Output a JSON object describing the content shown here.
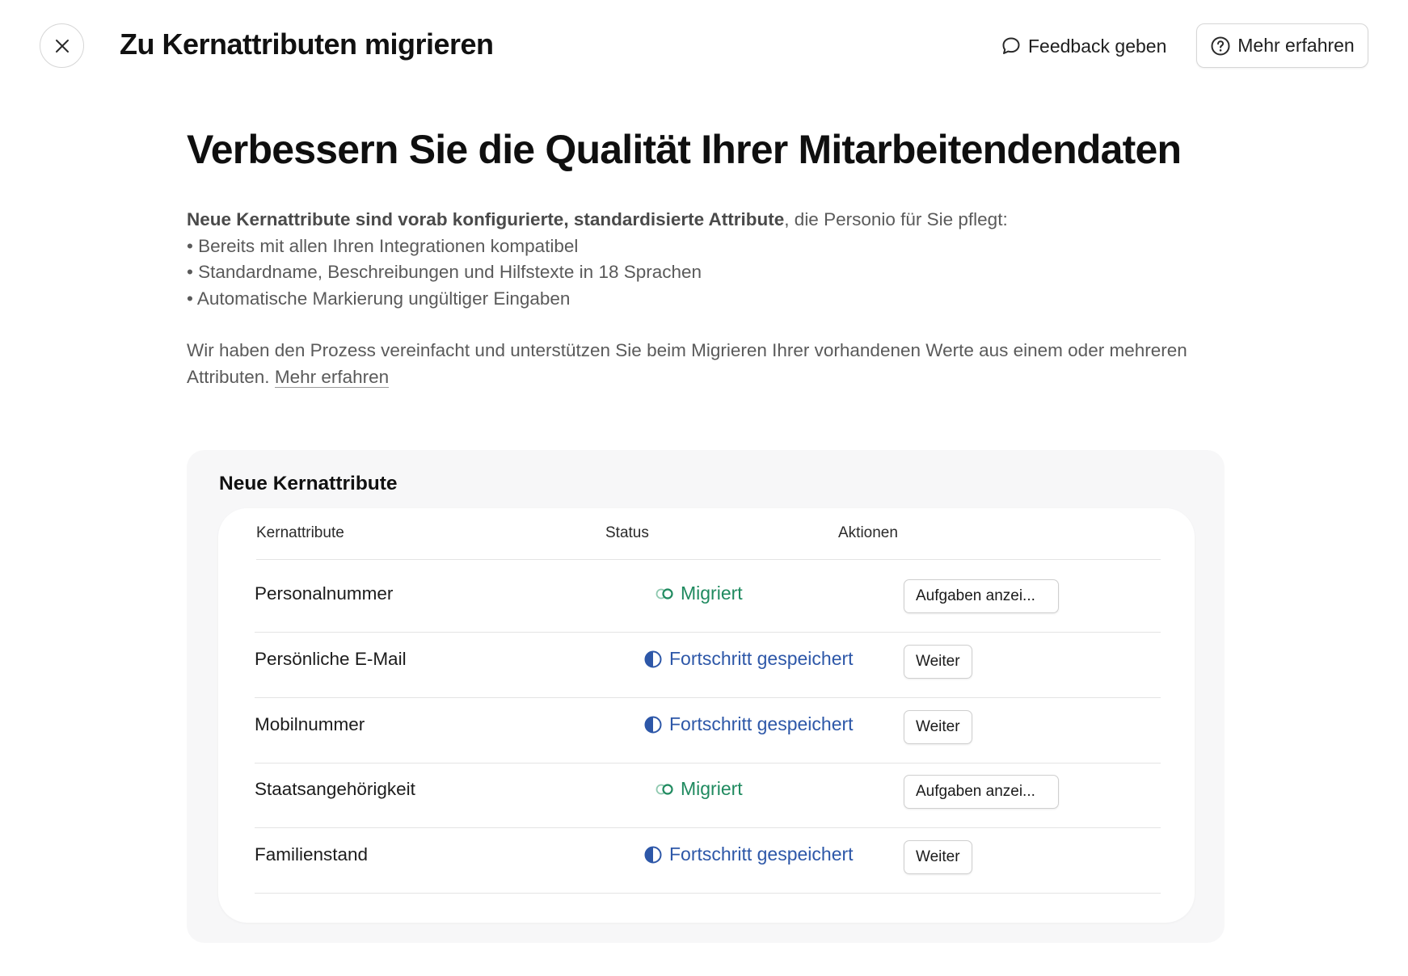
{
  "header": {
    "title": "Zu Kernattributen migrieren",
    "feedback_label": "Feedback geben",
    "learn_more_label": "Mehr erfahren"
  },
  "hero": {
    "title": "Verbessern Sie die Qualität Ihrer Mitarbeitendendaten",
    "intro_bold": "Neue Kernattribute sind vorab konfigurierte, standardisierte Attribute",
    "intro_rest": ", die Personio für Sie pflegt:",
    "bullets": [
      "Bereits mit allen Ihren Integrationen kompatibel",
      "Standardname, Beschreibungen und Hilfstexte in 18 Sprachen",
      "Automatische Markierung ungültiger Eingaben"
    ],
    "paragraph": "Wir haben den Prozess vereinfacht und unterstützen Sie beim Migrieren Ihrer vorhandenen Werte aus einem oder mehreren Attributen.",
    "paragraph_link": "Mehr erfahren"
  },
  "table": {
    "title": "Neue Kernattribute",
    "columns": [
      "Kernattribute",
      "Status",
      "Aktionen"
    ],
    "rows": [
      {
        "name": "Personalnummer",
        "status": "Migriert",
        "action": "Aufgaben anzei..."
      },
      {
        "name": "Persönliche E-Mail",
        "status": "Fortschritt gespeichert",
        "action": "Weiter"
      },
      {
        "name": "Mobilnummer",
        "status": "Fortschritt gespeichert",
        "action": "Weiter"
      },
      {
        "name": "Staatsangehörigkeit",
        "status": "Migriert",
        "action": "Aufgaben anzei..."
      },
      {
        "name": "Familienstand",
        "status": "Fortschritt gespeichert",
        "action": "Weiter"
      }
    ]
  },
  "icons": {
    "close": "close-icon",
    "feedback": "speech-bubble-icon",
    "help": "question-circle-icon",
    "migrated": "toggle-on-icon",
    "progress": "half-circle-icon"
  },
  "colors": {
    "migrated": "#1f8a5f",
    "progress": "#2d57a8"
  }
}
